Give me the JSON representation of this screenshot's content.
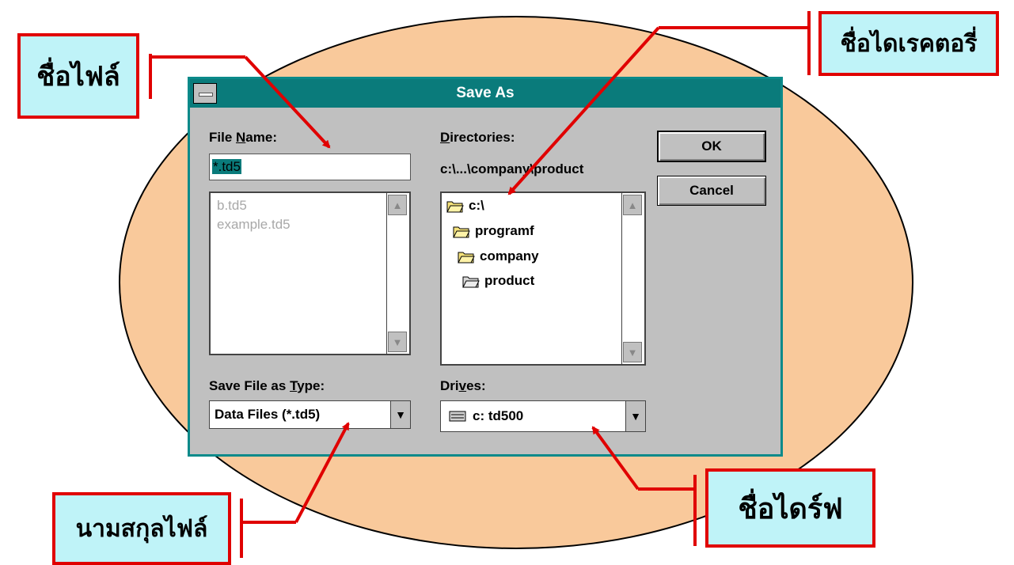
{
  "dialog": {
    "title": "Save As",
    "file_name": {
      "label_pre": "File ",
      "label_u": "N",
      "label_post": "ame:",
      "value": "*.td5",
      "files": [
        "b.td5",
        "example.td5"
      ]
    },
    "directories": {
      "label_u": "D",
      "label_post": "irectories:",
      "current_path": "c:\\...\\company\\product",
      "tree": [
        "c:\\",
        "programf",
        "company",
        "product"
      ]
    },
    "save_type": {
      "label_pre": "Save File as ",
      "label_u": "T",
      "label_post": "ype:",
      "value": "Data Files (*.td5)"
    },
    "drives": {
      "label_pre": "Dri",
      "label_u": "v",
      "label_post": "es:",
      "value": "c: td500"
    },
    "ok_label": "OK",
    "cancel_label": "Cancel"
  },
  "callouts": {
    "file_name": "ชื่อไฟล์",
    "directory": "ชื่อไดเรคตอรี่",
    "extension": "นามสกุลไฟล์",
    "drive": "ชื่อไดร์ฟ"
  },
  "colors": {
    "title_bar": "#0a7b7b",
    "dialog_bg": "#c0c0c0",
    "ellipse": "#f9c99b",
    "callout_bg": "#bff3f8",
    "callout_border": "#e00000",
    "arrow": "#e00000"
  }
}
